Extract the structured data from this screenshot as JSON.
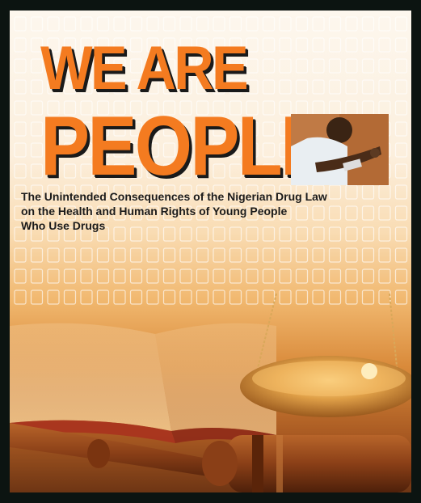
{
  "cover": {
    "title_line_1": "WE ARE",
    "title_line_2": "PEOPLE",
    "subtitle_lines": [
      "The Unintended Consequences of the Nigerian Drug Law",
      "on the Health and Human Rights of Young People",
      "Who Use Drugs"
    ]
  },
  "colors": {
    "title": "#f47b20",
    "title_shadow": "#1a1a1a",
    "subtitle": "#1b1b1b",
    "frame": "#0c1411"
  }
}
